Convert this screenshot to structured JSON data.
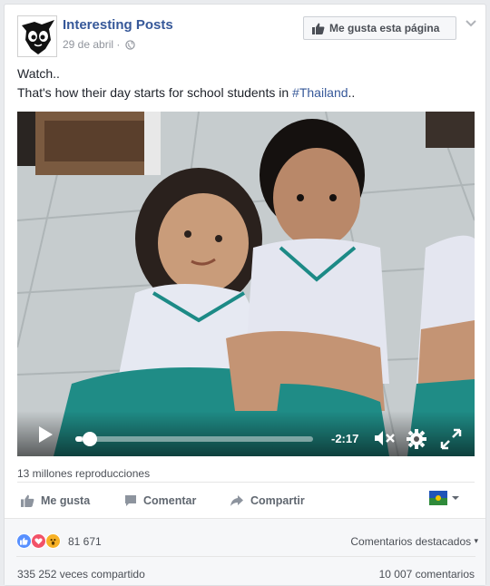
{
  "post": {
    "page_name": "Interesting Posts",
    "date": "29 de abril",
    "separator": "·",
    "like_page_label": "Me gusta esta página",
    "text_line1": "Watch..",
    "text_line2_prefix": "That's how their day starts for school students in ",
    "hashtag": "#Thailand",
    "text_line2_suffix": ".."
  },
  "video": {
    "time_remaining": "-2:17",
    "progress": 0.03
  },
  "views_label": "13 millones reproducciones",
  "actions": {
    "like": "Me gusta",
    "comment": "Comentar",
    "share": "Compartir"
  },
  "reactions": {
    "icons": [
      "like-reaction-icon",
      "love-reaction-icon",
      "wow-reaction-icon"
    ],
    "count": "81 671",
    "top_comments_label": "Comentarios destacados",
    "shares_label": "335 252 veces compartido",
    "comments_label": "10 007 comentarios"
  },
  "colors": {
    "link": "#365899",
    "like_blue": "#5890ff",
    "love_red": "#f25268",
    "wow_yellow": "#f7b125"
  }
}
